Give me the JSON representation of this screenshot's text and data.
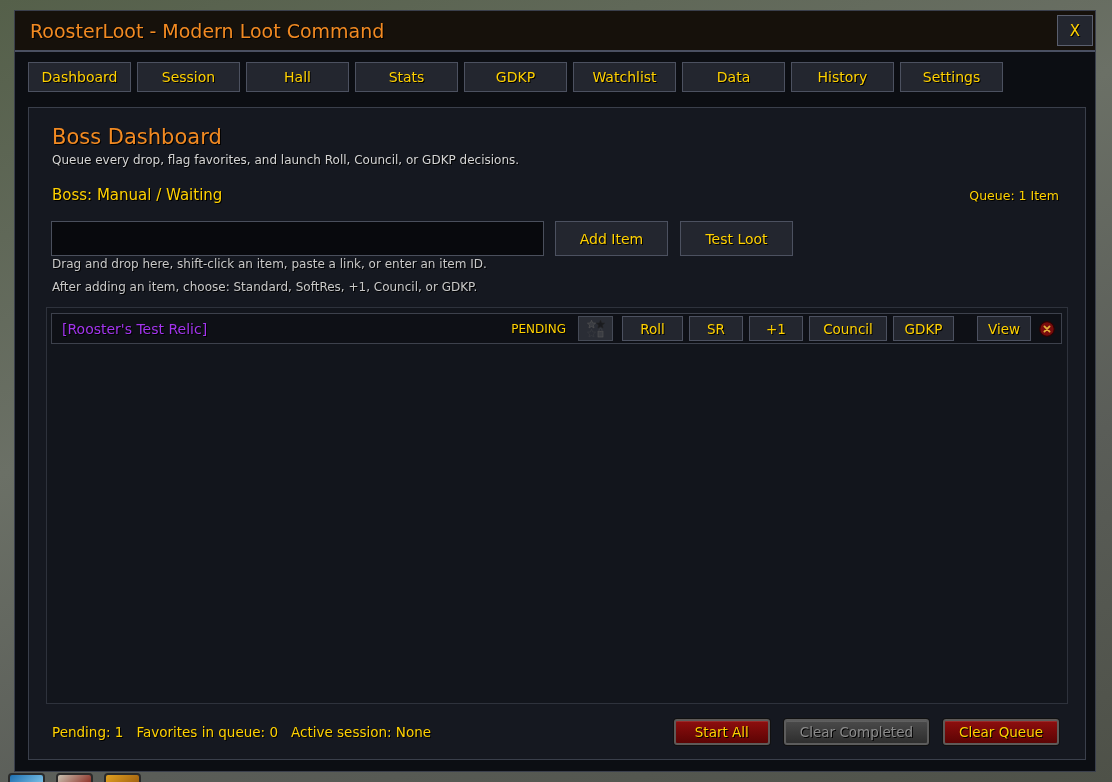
{
  "window": {
    "title": "RoosterLoot - Modern Loot Command",
    "close_label": "X"
  },
  "tabs": [
    {
      "label": "Dashboard"
    },
    {
      "label": "Session"
    },
    {
      "label": "Hall"
    },
    {
      "label": "Stats"
    },
    {
      "label": "GDKP"
    },
    {
      "label": "Watchlist"
    },
    {
      "label": "Data"
    },
    {
      "label": "History"
    },
    {
      "label": "Settings"
    }
  ],
  "dashboard": {
    "heading": "Boss Dashboard",
    "subtitle": "Queue every drop, flag favorites, and launch Roll, Council, or GDKP decisions.",
    "boss": "Boss: Manual / Waiting",
    "queue_count": "Queue: 1 Item",
    "input_buttons": [
      "Add Item",
      "Test Loot"
    ],
    "hints": [
      "Drag and drop here, shift-click an item, paste a link, or enter an item ID.",
      "After adding an item, choose: Standard, SoftRes, +1, Council, or GDKP."
    ]
  },
  "queue": [
    {
      "item": "[Rooster's Test Relic]",
      "color": "#a335ee",
      "status": "PENDING",
      "favorite": false,
      "actions": [
        "Roll",
        "SR",
        "+1",
        "Council",
        "GDKP"
      ],
      "view": "View"
    }
  ],
  "footer": {
    "stats": [
      "Pending: 1",
      "Favorites in queue: 0",
      "Active session: None"
    ],
    "buttons": [
      {
        "label": "Start All",
        "disabled": false
      },
      {
        "label": "Clear Completed",
        "disabled": true
      },
      {
        "label": "Clear Queue",
        "disabled": false
      }
    ]
  }
}
